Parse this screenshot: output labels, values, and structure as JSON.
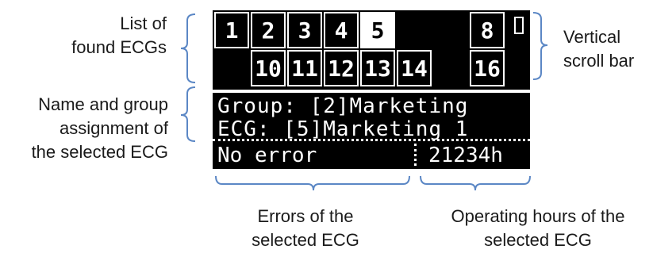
{
  "annotations": {
    "list": [
      "List of",
      "found ECGs"
    ],
    "name": [
      "Name and group",
      "assignment of",
      "the selected ECG"
    ],
    "scroll": [
      "Vertical",
      "scroll bar"
    ],
    "errors": [
      "Errors of the",
      "selected ECG"
    ],
    "hours": [
      "Operating hours of the",
      "selected ECG"
    ]
  },
  "display": {
    "row1": [
      "1",
      "2",
      "3",
      "4",
      "5",
      "",
      "",
      "8"
    ],
    "row2": [
      "",
      "10",
      "11",
      "12",
      "13",
      "14",
      "",
      "16"
    ],
    "group_line": "Group: [2]Marketing",
    "ecg_line": "ECG: [5]Marketing 1",
    "error_text": "No error",
    "hours_text": "21234h"
  },
  "colors": {
    "lcd_bg": "#000000",
    "lcd_fg": "#ffffff",
    "brace": "#5b87c5",
    "text": "#1a1a1a"
  }
}
